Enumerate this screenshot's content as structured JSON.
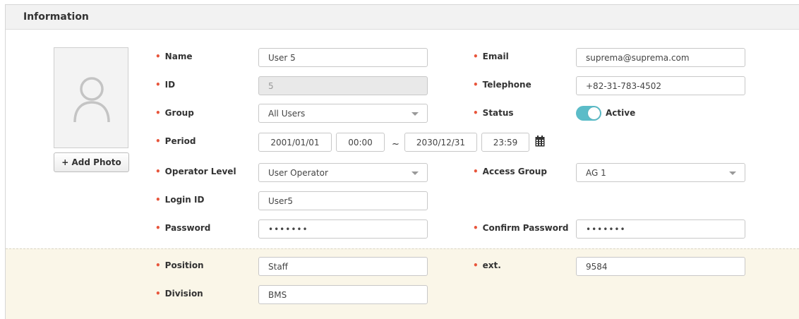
{
  "panel": {
    "title": "Information"
  },
  "photo": {
    "add_label": "+ Add Photo"
  },
  "fields": {
    "name": {
      "label": "Name",
      "value": "User 5"
    },
    "id": {
      "label": "ID",
      "value": "5"
    },
    "group": {
      "label": "Group",
      "value": "All Users"
    },
    "period": {
      "label": "Period",
      "start_date": "2001/01/01",
      "start_time": "00:00",
      "separator": "~",
      "end_date": "2030/12/31",
      "end_time": "23:59"
    },
    "operator_level": {
      "label": "Operator Level",
      "value": "User Operator"
    },
    "login_id": {
      "label": "Login ID",
      "value": "User5"
    },
    "password": {
      "label": "Password",
      "value": "•••••••"
    },
    "email": {
      "label": "Email",
      "value": "suprema@suprema.com"
    },
    "telephone": {
      "label": "Telephone",
      "value": "+82-31-783-4502"
    },
    "status": {
      "label": "Status",
      "value": "Active",
      "enabled": true
    },
    "access_group": {
      "label": "Access Group",
      "value": "AG 1"
    },
    "confirm_password": {
      "label": "Confirm Password",
      "value": "•••••••"
    },
    "position": {
      "label": "Position",
      "value": "Staff"
    },
    "ext": {
      "label": "ext.",
      "value": "9584"
    },
    "division": {
      "label": "Division",
      "value": "BMS"
    }
  },
  "icons": {
    "avatar": "user-silhouette-icon",
    "calendar": "calendar-icon",
    "dropdown": "chevron-down-icon"
  },
  "colors": {
    "required_dot": "#e8553b",
    "toggle_on": "#5bbcc8",
    "extra_section_bg": "#faf6e8"
  }
}
